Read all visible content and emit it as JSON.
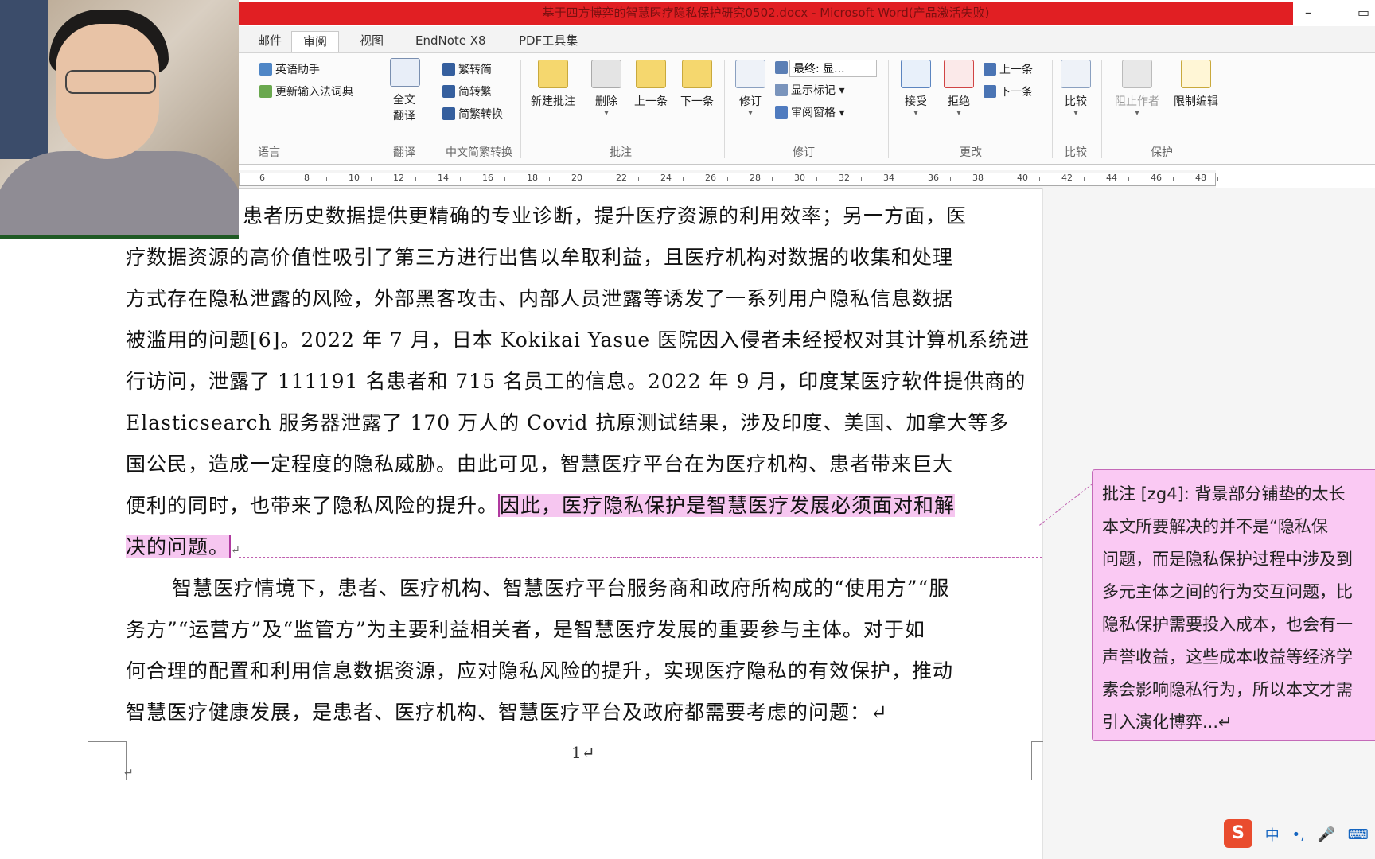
{
  "window": {
    "title": "基于四方博弈的智慧医疗隐私保护研究0502.docx - Microsoft Word(产品激活失败)",
    "minimize": "–",
    "restore": "▭"
  },
  "tabs": [
    "邮件",
    "审阅",
    "视图",
    "EndNote X8",
    "PDF工具集"
  ],
  "ribbon": {
    "language": {
      "items": [
        "英语助手",
        "更新输入法词典"
      ],
      "label": "语言"
    },
    "translate": {
      "button": "全文\n翻译",
      "btn_line1": "全文",
      "btn_line2": "翻译",
      "label": "翻译"
    },
    "chinese_convert": {
      "items": [
        "繁转简",
        "简转繁",
        "简繁转换"
      ],
      "label": "中文简繁转换"
    },
    "comments": {
      "buttons": [
        "新建批注",
        "删除",
        "上一条",
        "下一条"
      ],
      "label": "批注"
    },
    "tracking": {
      "track_button": "修订",
      "display_select": "最终: 显...",
      "show_markup": "显示标记",
      "review_pane": "审阅窗格",
      "label": "修订"
    },
    "changes": {
      "accept": "接受",
      "reject": "拒绝",
      "previous": "上一条",
      "next": "下一条",
      "label": "更改"
    },
    "compare": {
      "button": "比较",
      "label": "比较"
    },
    "protect": {
      "block_authors": "阻止作者",
      "restrict": "限制编辑",
      "label": "保护"
    }
  },
  "ruler": {
    "numbers": [
      "6",
      "8",
      "10",
      "12",
      "14",
      "16",
      "18",
      "20",
      "22",
      "24",
      "26",
      "28",
      "30",
      "32",
      "34",
      "36",
      "38",
      "40",
      "42",
      "44",
      "46",
      "48"
    ]
  },
  "document": {
    "lines": [
      "患者历史数据提供更精确的专业诊断，提升医疗资源的利用效率；另一方面，医",
      "疗数据资源的高价值性吸引了第三方进行出售以牟取利益，且医疗机构对数据的收集和处理",
      "方式存在隐私泄露的风险，外部黑客攻击、内部人员泄露等诱发了一系列用户隐私信息数据",
      "被滥用的问题[6]。2022 年 7 月，日本 Kokikai Yasue 医院因入侵者未经授权对其计算机系统进",
      "行访问，泄露了 111191 名患者和 715 名员工的信息。2022 年 9 月，印度某医疗软件提供商的",
      "Elasticsearch 服务器泄露了 170 万人的 Covid 抗原测试结果，涉及印度、美国、加拿大等多",
      "国公民，造成一定程度的隐私威胁。由此可见，智慧医疗平台在为医疗机构、患者带来巨大",
      "便利的同时，也带来了隐私风险的提升。",
      "决的问题。",
      "智慧医疗情境下，患者、医疗机构、智慧医疗平台服务商和政府所构成的“使用方”“服",
      "务方”“运营方”及“监管方”为主要利益相关者，是智慧医疗发展的重要参与主体。对于如",
      "何合理的配置和利用信息数据资源，应对隐私风险的提升，实现医疗隐私的有效保护，推动",
      "智慧医疗健康发展，是患者、医疗机构、智慧医疗平台及政府都需要考虑的问题：↵"
    ],
    "highlight_1": "因此，医疗隐私保护是智慧医疗发展必须面对和解",
    "para_mark": "↵",
    "page_number": "1↵",
    "end_mark": "↵"
  },
  "comment": {
    "lines": [
      "批注 [zg4]: 背景部分铺垫的太长",
      "本文所要解决的并不是“隐私保",
      "问题，而是隐私保护过程中涉及到",
      "多元主体之间的行为交互问题，比",
      "隐私保护需要投入成本，也会有一",
      "声誉收益，这些成本收益等经济学",
      "素会影响隐私行为，所以本文才需",
      "引入演化博弈...↵"
    ]
  },
  "statusbar": {
    "ime_logo": "S",
    "ime_mode": "中",
    "punct": "•,",
    "mic": "🎤",
    "keyboard": "⌨"
  }
}
